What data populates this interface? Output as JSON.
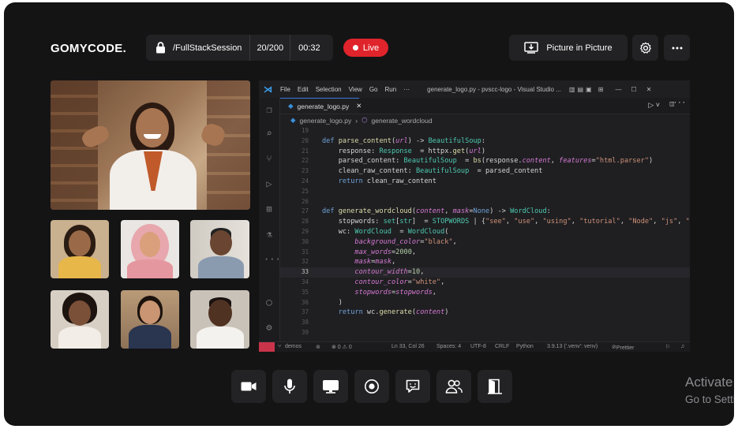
{
  "header": {
    "logo_text": "GOMYCODE.",
    "session_name": "/FullStackSession",
    "participants": "20/200",
    "timer": "00:32",
    "live_label": "Live",
    "pip_label": "Picture in Picture"
  },
  "vscode": {
    "menu": [
      "File",
      "Edit",
      "Selection",
      "View",
      "Go",
      "Run",
      "···"
    ],
    "window_title": "generate_logo.py - pvscc-logo - Visual Studio ...",
    "tab_name": "generate_logo.py",
    "breadcrumb_file": "generate_logo.py",
    "breadcrumb_symbol": "generate_wordcloud",
    "lines": [
      {
        "n": "19",
        "t": ""
      },
      {
        "n": "20",
        "t": "def parse_content(url) -> BeautifulSoup:"
      },
      {
        "n": "21",
        "t": "    response: Response  = httpx.get(url)"
      },
      {
        "n": "22",
        "t": "    parsed_content: BeautifulSoup  = bs(response.content, features=\"html.parser\")"
      },
      {
        "n": "23",
        "t": "    clean_raw_content: BeautifulSoup  = parsed_content"
      },
      {
        "n": "24",
        "t": "    return clean_raw_content"
      },
      {
        "n": "25",
        "t": ""
      },
      {
        "n": "26",
        "t": ""
      },
      {
        "n": "27",
        "t": "def generate_wordcloud(content, mask=None) -> WordCloud:"
      },
      {
        "n": "28",
        "t": "    stopwords: set[str]  = STOPWORDS | {\"see\", \"use\", \"using\", \"tutorial\", \"Node\", \"js\", \"f"
      },
      {
        "n": "29",
        "t": "    wc: WordCloud  = WordCloud("
      },
      {
        "n": "30",
        "t": "        background_color=\"black\","
      },
      {
        "n": "31",
        "t": "        max_words=2000,"
      },
      {
        "n": "32",
        "t": "        mask=mask,"
      },
      {
        "n": "33",
        "t": "        contour_width=10,"
      },
      {
        "n": "34",
        "t": "        contour_color=\"white\","
      },
      {
        "n": "35",
        "t": "        stopwords=stopwords,"
      },
      {
        "n": "36",
        "t": "    )"
      },
      {
        "n": "37",
        "t": "    return wc.generate(content)"
      },
      {
        "n": "38",
        "t": ""
      },
      {
        "n": "39",
        "t": ""
      }
    ],
    "current_line": "33",
    "status": {
      "branch": "demos",
      "problems": "⊗ 0 ⚠ 0",
      "position": "Ln 33, Col 26",
      "spaces": "Spaces: 4",
      "encoding": "UTF-8",
      "eol": "CRLF",
      "language": "Python",
      "interpreter": "3.9.13 ('.venv': venv)",
      "formatter": "Prettier"
    }
  },
  "controls": [
    {
      "name": "camera-button",
      "icon": "video-icon"
    },
    {
      "name": "microphone-button",
      "icon": "mic-icon"
    },
    {
      "name": "share-screen-button",
      "icon": "monitor-icon"
    },
    {
      "name": "record-button",
      "icon": "record-icon"
    },
    {
      "name": "chat-button",
      "icon": "chat-icon"
    },
    {
      "name": "participants-button",
      "icon": "people-icon"
    },
    {
      "name": "leave-button",
      "icon": "exit-icon"
    }
  ],
  "watermark": {
    "line1": "Activate",
    "line2": "Go to Setti"
  },
  "colors": {
    "background": "#141415",
    "panel": "#222224",
    "live": "#e0242b",
    "vscode_bg": "#1f1f22"
  }
}
